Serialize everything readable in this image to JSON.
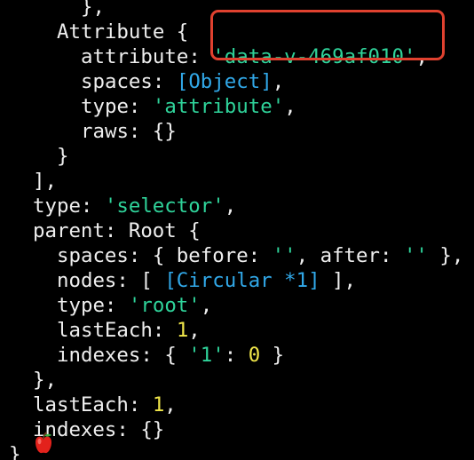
{
  "colors": {
    "background": "#000000",
    "text": "#eeeeee",
    "string": "#2fd39a",
    "number": "#f0e64a",
    "reference": "#31a8e8",
    "highlight": "#e0412f"
  },
  "lines": [
    {
      "indent": 3,
      "tokens": [
        {
          "t": "},",
          "c": "punc"
        }
      ]
    },
    {
      "indent": 2,
      "tokens": [
        {
          "t": "Attribute {",
          "c": "key"
        }
      ]
    },
    {
      "indent": 3,
      "tokens": [
        {
          "t": "attribute: ",
          "c": "key"
        },
        {
          "t": "'data-v-469af010'",
          "c": "str"
        },
        {
          "t": ",",
          "c": "punc"
        }
      ]
    },
    {
      "indent": 3,
      "tokens": [
        {
          "t": "spaces: ",
          "c": "key"
        },
        {
          "t": "[Object]",
          "c": "ref"
        },
        {
          "t": ",",
          "c": "punc"
        }
      ]
    },
    {
      "indent": 3,
      "tokens": [
        {
          "t": "type: ",
          "c": "key"
        },
        {
          "t": "'attribute'",
          "c": "str"
        },
        {
          "t": ",",
          "c": "punc"
        }
      ]
    },
    {
      "indent": 3,
      "tokens": [
        {
          "t": "raws: {}",
          "c": "key"
        }
      ]
    },
    {
      "indent": 2,
      "tokens": [
        {
          "t": "}",
          "c": "punc"
        }
      ]
    },
    {
      "indent": 1,
      "tokens": [
        {
          "t": "],",
          "c": "punc"
        }
      ]
    },
    {
      "indent": 1,
      "tokens": [
        {
          "t": "type: ",
          "c": "key"
        },
        {
          "t": "'selector'",
          "c": "str"
        },
        {
          "t": ",",
          "c": "punc"
        }
      ]
    },
    {
      "indent": 1,
      "tokens": [
        {
          "t": "parent: Root {",
          "c": "key"
        }
      ]
    },
    {
      "indent": 2,
      "tokens": [
        {
          "t": "spaces: { before: ",
          "c": "key"
        },
        {
          "t": "''",
          "c": "str"
        },
        {
          "t": ", after: ",
          "c": "key"
        },
        {
          "t": "''",
          "c": "str"
        },
        {
          "t": " },",
          "c": "punc"
        }
      ]
    },
    {
      "indent": 2,
      "tokens": [
        {
          "t": "nodes: [ ",
          "c": "key"
        },
        {
          "t": "[Circular *1]",
          "c": "ref"
        },
        {
          "t": " ],",
          "c": "punc"
        }
      ]
    },
    {
      "indent": 2,
      "tokens": [
        {
          "t": "type: ",
          "c": "key"
        },
        {
          "t": "'root'",
          "c": "str"
        },
        {
          "t": ",",
          "c": "punc"
        }
      ]
    },
    {
      "indent": 2,
      "tokens": [
        {
          "t": "lastEach: ",
          "c": "key"
        },
        {
          "t": "1",
          "c": "num"
        },
        {
          "t": ",",
          "c": "punc"
        }
      ]
    },
    {
      "indent": 2,
      "tokens": [
        {
          "t": "indexes: { ",
          "c": "key"
        },
        {
          "t": "'1'",
          "c": "str"
        },
        {
          "t": ": ",
          "c": "key"
        },
        {
          "t": "0",
          "c": "num"
        },
        {
          "t": " }",
          "c": "punc"
        }
      ]
    },
    {
      "indent": 1,
      "tokens": [
        {
          "t": "},",
          "c": "punc"
        }
      ]
    },
    {
      "indent": 1,
      "tokens": [
        {
          "t": "lastEach: ",
          "c": "key"
        },
        {
          "t": "1",
          "c": "num"
        },
        {
          "t": ",",
          "c": "punc"
        }
      ]
    },
    {
      "indent": 1,
      "tokens": [
        {
          "t": "indexes: {}",
          "c": "key"
        }
      ]
    },
    {
      "indent": 0,
      "tokens": [
        {
          "t": "}",
          "c": "punc"
        }
      ]
    }
  ],
  "prompt_icon": "apple-icon",
  "highlight_target": "attribute-value"
}
